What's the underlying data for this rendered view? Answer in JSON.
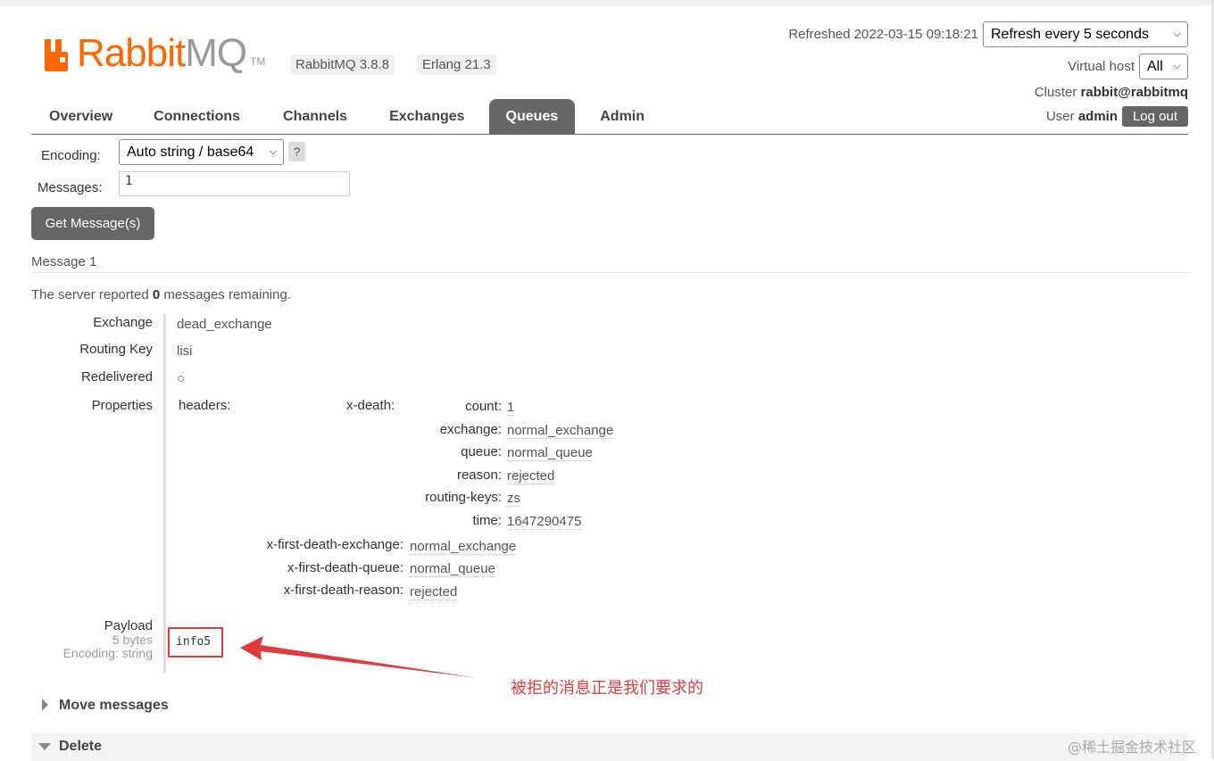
{
  "app": {
    "logo_rabbit": "Rabbit",
    "logo_mq": "MQ",
    "logo_tm": "TM",
    "version_badge": "RabbitMQ 3.8.8",
    "erlang_badge": "Erlang 21.3",
    "brand_color": "#ff6600"
  },
  "header": {
    "refreshed": "Refreshed 2022-03-15 09:18:21",
    "refresh_select": "Refresh every 5 seconds",
    "vhost_label": "Virtual host",
    "vhost_select": "All",
    "cluster_label": "Cluster",
    "cluster_value": "rabbit@rabbitmq",
    "user_label": "User",
    "user_value": "admin",
    "logout": "Log out"
  },
  "tabs": [
    {
      "label": "Overview",
      "active": false
    },
    {
      "label": "Connections",
      "active": false
    },
    {
      "label": "Channels",
      "active": false
    },
    {
      "label": "Exchanges",
      "active": false
    },
    {
      "label": "Queues",
      "active": true
    },
    {
      "label": "Admin",
      "active": false
    }
  ],
  "get_messages": {
    "encoding_label": "Encoding:",
    "encoding_value": "Auto string / base64",
    "help": "?",
    "messages_label": "Messages:",
    "messages_value": "1",
    "button": "Get Message(s)"
  },
  "message": {
    "title": "Message 1",
    "remaining_prefix": "The server reported",
    "remaining_count": "0",
    "remaining_suffix": "messages remaining.",
    "exchange_label": "Exchange",
    "exchange_value": "dead_exchange",
    "routing_key_label": "Routing Key",
    "routing_key_value": "lisi",
    "redelivered_label": "Redelivered",
    "redelivered_value": "○",
    "properties_label": "Properties",
    "headers_label": "headers:",
    "x_death_label": "x-death:",
    "x_death": [
      {
        "key": "count:",
        "value": "1"
      },
      {
        "key": "exchange:",
        "value": "normal_exchange"
      },
      {
        "key": "queue:",
        "value": "normal_queue"
      },
      {
        "key": "reason:",
        "value": "rejected"
      },
      {
        "key": "routing-keys:",
        "value": "zs"
      },
      {
        "key": "time:",
        "value": "1647290475"
      }
    ],
    "first_death": [
      {
        "key": "x-first-death-exchange:",
        "value": "normal_exchange"
      },
      {
        "key": "x-first-death-queue:",
        "value": "normal_queue"
      },
      {
        "key": "x-first-death-reason:",
        "value": "rejected"
      }
    ],
    "payload_label": "Payload",
    "payload_size": "5 bytes",
    "payload_encoding": "Encoding: string",
    "payload_value": "info5"
  },
  "annotation": {
    "text": "被拒的消息正是我们要求的",
    "color": "#e03a3a"
  },
  "sections": {
    "move": "Move messages",
    "delete": "Delete"
  },
  "watermark": "@稀土掘金技术社区"
}
